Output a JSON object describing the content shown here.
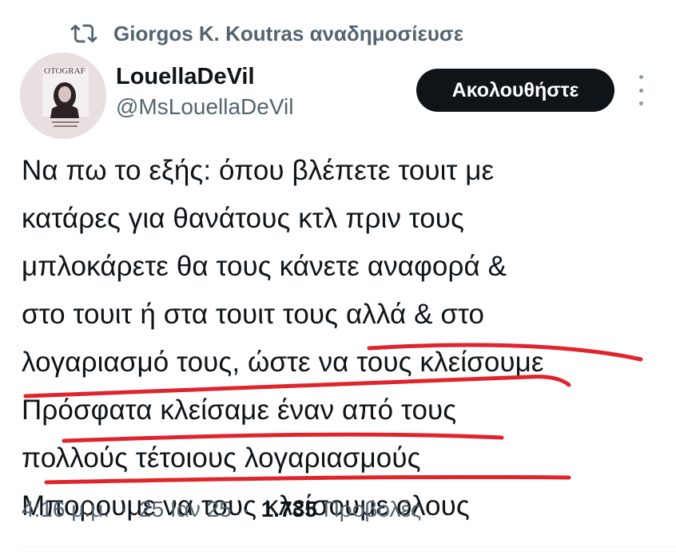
{
  "repost": {
    "icon": "repost-icon",
    "text": "Giorgos K. Koutras αναδημοσίευσε"
  },
  "author": {
    "display_name": "LouellaDeVil",
    "handle": "@MsLouellaDeVil",
    "avatar_text": "OTOGRAF"
  },
  "actions": {
    "follow_label": "Ακολουθήστε",
    "more_icon": "more-vertical-icon"
  },
  "tweet": {
    "lines": [
      "Να πω το εξής: όπου βλέπετε τουιτ με",
      "κατάρες για θανάτους κτλ πριν τους",
      "μπλοκάρετε θα τους κάνετε αναφορά &",
      "στο τουιτ ή στα τουιτ τους αλλά & στο",
      "λογαριασμό τους, ώστε να τους κλείσουμε",
      "Πρόσφατα κλείσαμε έναν από τους",
      "πολλούς τέτοιους λογαριασμούς",
      "Μπορουμε να τους κλείσουμε ολους"
    ]
  },
  "meta": {
    "time": "4:16 μ.μ.",
    "separator": "·",
    "date": "25 Ιαν 25",
    "views_count": "1.735",
    "views_label": "Προβολές"
  },
  "colors": {
    "text": "#0f1419",
    "secondary": "#536471",
    "button_bg": "#0f1419",
    "underline": "#e0242b"
  }
}
